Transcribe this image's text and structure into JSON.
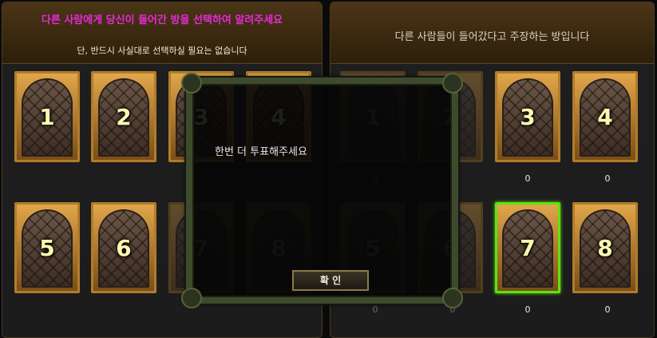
{
  "left_panel": {
    "title": "다른 사람에게 당신이 들어간 방을 선택하여 알려주세요",
    "subtitle": "단, 반드시 사실대로 선택하실 필요는 없습니다",
    "doors": [
      "1",
      "2",
      "3",
      "4",
      "5",
      "6",
      "7",
      "8"
    ]
  },
  "right_panel": {
    "title": "다른 사람들이 들어갔다고 주장하는 방입니다",
    "doors": [
      "1",
      "2",
      "3",
      "4",
      "5",
      "6",
      "7",
      "8"
    ],
    "counts": [
      "0",
      "0",
      "0",
      "0",
      "0",
      "0",
      "0",
      "0"
    ],
    "selected_door": "7"
  },
  "modal": {
    "message": "한번 더 투표해주세요",
    "confirm_label": "확 인"
  },
  "colors": {
    "title_magenta": "#e62ad6",
    "door_frame_gold": "#b17c2a",
    "selected_green": "#5fe20f"
  }
}
